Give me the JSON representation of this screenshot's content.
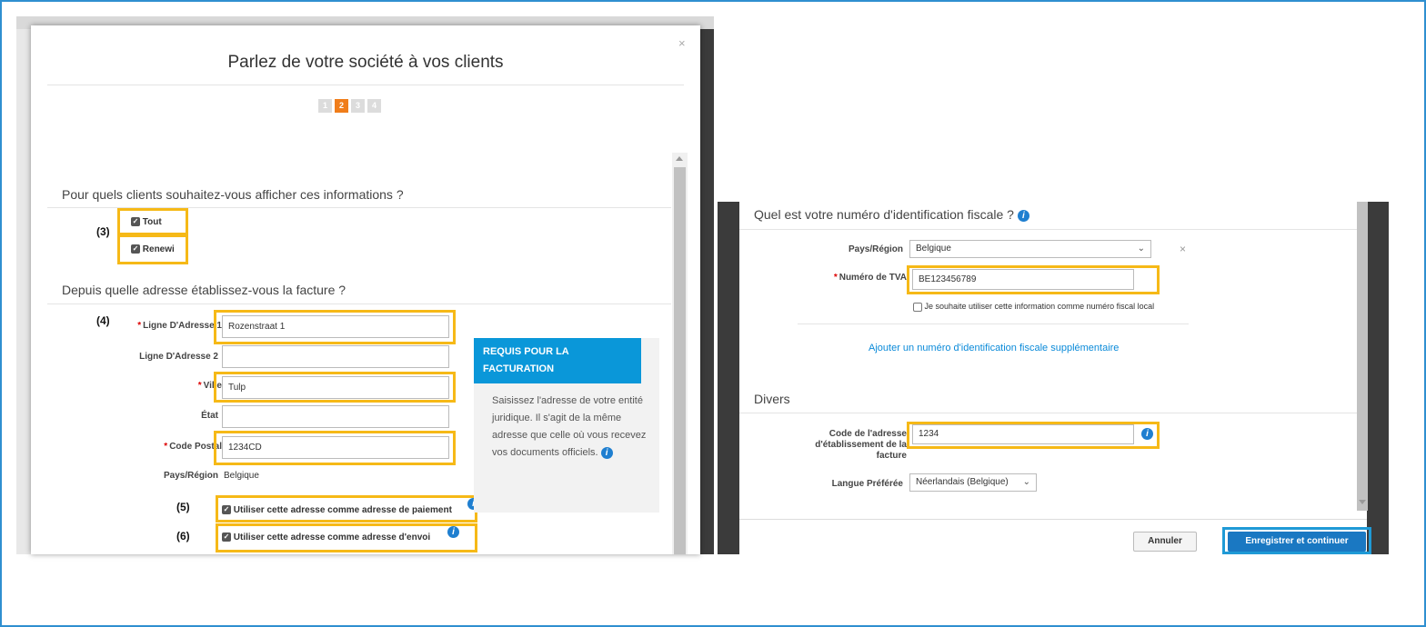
{
  "left": {
    "modal_title": "Parlez de votre société à vos clients",
    "close_symbol": "×",
    "steps": [
      "1",
      "2",
      "3",
      "4"
    ],
    "active_step": "2",
    "section1_title": "Pour quels clients souhaitez-vous afficher ces informations ?",
    "clients": [
      {
        "label": "Tout",
        "checked": true
      },
      {
        "label": "Renewi",
        "checked": true
      }
    ],
    "section2_title": "Depuis quelle adresse établissez-vous la facture ?",
    "fields": {
      "address1": {
        "label": "Ligne D'Adresse 1",
        "value": "Rozenstraat 1",
        "required": true
      },
      "address2": {
        "label": "Ligne D'Adresse 2",
        "value": ""
      },
      "city": {
        "label": "Ville",
        "value": "Tulp",
        "required": true
      },
      "state": {
        "label": "État",
        "value": ""
      },
      "postal": {
        "label": "Code Postal",
        "value": "1234CD",
        "required": true
      },
      "country_label": "Pays/Région",
      "country_value": "Belgique"
    },
    "payment_checkbox": "Utiliser cette adresse comme adresse de paiement",
    "shipping_checkbox": "Utiliser cette adresse comme adresse d'envoi",
    "info_box": {
      "heading": "REQUIS POUR LA FACTURATION",
      "body": "Saisissez l'adresse de votre entité juridique. Il s'agit de la même adresse que celle où vous recevez vos documents officiels."
    },
    "markers": {
      "m3": "(3)",
      "m4": "(4)",
      "m5": "(5)",
      "m6": "(6)"
    }
  },
  "right": {
    "tax_title": "Quel est votre numéro d'identification fiscale ?",
    "country_label": "Pays/Région",
    "country_value": "Belgique",
    "remove_symbol": "×",
    "vat_label": "Numéro de TVA",
    "vat_value": "BE123456789",
    "local_tax_checkbox": "Je souhaite utiliser cette information comme numéro fiscal local",
    "add_tax_link": "Ajouter un numéro d'identification fiscale supplémentaire",
    "misc_title": "Divers",
    "address_code_label_1": "Code de l'adresse",
    "address_code_label_2": "d'établissement de la",
    "address_code_label_3": "facture",
    "address_code_value": "1234",
    "language_label": "Langue Préférée",
    "language_value": "Néerlandais (Belgique)",
    "cancel_label": "Annuler",
    "save_label": "Enregistrer et continuer"
  },
  "colors": {
    "highlight": "#f6b917",
    "highlight_blue": "#1f9ad6",
    "active_step": "#f07d1a",
    "info_head": "#0a97d9",
    "primary_button": "#1a78c2"
  },
  "icons": [
    "close-icon",
    "info-icon",
    "checkbox-checked-icon",
    "chevron-down-icon",
    "scroll-up-icon",
    "scroll-down-icon"
  ]
}
